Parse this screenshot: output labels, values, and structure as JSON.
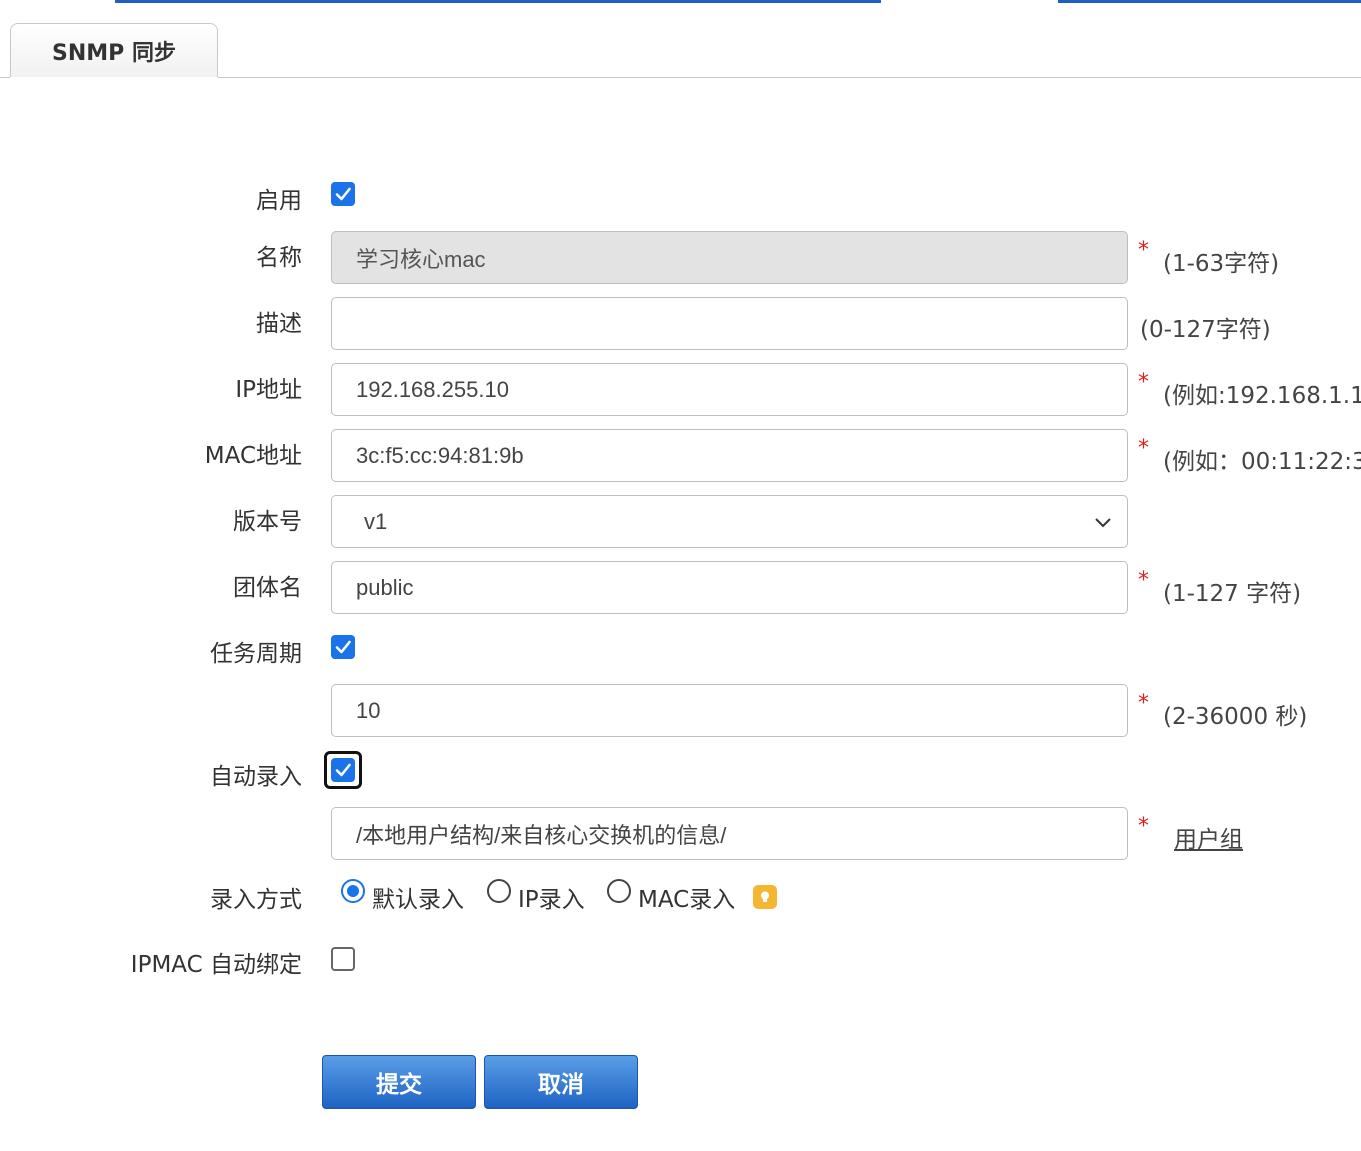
{
  "tab": {
    "label": "SNMP 同步"
  },
  "form": {
    "enable": {
      "label": "启用",
      "checked": true
    },
    "name": {
      "label": "名称",
      "value": "学习核心mac",
      "hint": "(1-63字符)"
    },
    "description": {
      "label": "描述",
      "value": "",
      "hint": "(0-127字符)"
    },
    "ip": {
      "label": "IP地址",
      "value": "192.168.255.10",
      "hint": "(例如:192.168.1.1,"
    },
    "mac": {
      "label": "MAC地址",
      "value": "3c:f5:cc:94:81:9b",
      "hint": "(例如：00:11:22:3"
    },
    "version": {
      "label": "版本号",
      "value": "v1"
    },
    "community": {
      "label": "团体名",
      "value": "public",
      "hint": "(1-127 字符)"
    },
    "task_period": {
      "label": "任务周期",
      "checked": true,
      "value": "10",
      "hint": "(2-36000 秒)"
    },
    "auto_entry": {
      "label": "自动录入",
      "checked": true,
      "value": "/本地用户结构/来自核心交换机的信息/",
      "link": "用户组"
    },
    "entry_method": {
      "label": "录入方式",
      "options": [
        "默认录入",
        "IP录入",
        "MAC录入"
      ],
      "selected": "默认录入"
    },
    "ipmac_bind": {
      "label": "IPMAC 自动绑定",
      "checked": false
    },
    "required_mark": "*"
  },
  "buttons": {
    "submit": "提交",
    "cancel": "取消"
  },
  "colors": {
    "accent": "#1a73e8",
    "button": "#1e63c2",
    "required": "#e02020",
    "tip": "#f5b731"
  }
}
